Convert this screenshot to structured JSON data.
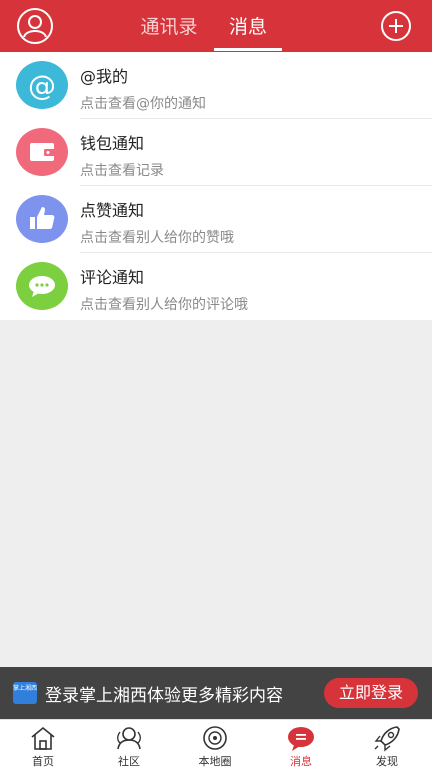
{
  "header": {
    "tabs": [
      {
        "label": "通讯录",
        "active": false
      },
      {
        "label": "消息",
        "active": true
      }
    ],
    "avatar_icon": "user-circle-icon",
    "add_icon": "plus-circle-icon",
    "brand_color": "#d6343a"
  },
  "messages": [
    {
      "title": "@我的",
      "subtitle": "点击查看@你的通知",
      "icon": "at-icon",
      "color": "#3cb8d9"
    },
    {
      "title": "钱包通知",
      "subtitle": "点击查看记录",
      "icon": "wallet-icon",
      "color": "#f06a7c"
    },
    {
      "title": "点赞通知",
      "subtitle": "点击查看别人给你的赞哦",
      "icon": "thumbs-up-icon",
      "color": "#7d93ee"
    },
    {
      "title": "评论通知",
      "subtitle": "点击查看别人给你的评论哦",
      "icon": "comment-icon",
      "color": "#7ccf3f"
    }
  ],
  "banner": {
    "logo_text": "掌上湘西",
    "text": "登录掌上湘西体验更多精彩内容",
    "button": "立即登录"
  },
  "tabbar": [
    {
      "label": "首页",
      "icon": "home-icon",
      "active": false
    },
    {
      "label": "社区",
      "icon": "community-icon",
      "active": false
    },
    {
      "label": "本地圈",
      "icon": "local-circle-icon",
      "active": false
    },
    {
      "label": "消息",
      "icon": "message-icon",
      "active": true
    },
    {
      "label": "发现",
      "icon": "rocket-icon",
      "active": false
    }
  ]
}
